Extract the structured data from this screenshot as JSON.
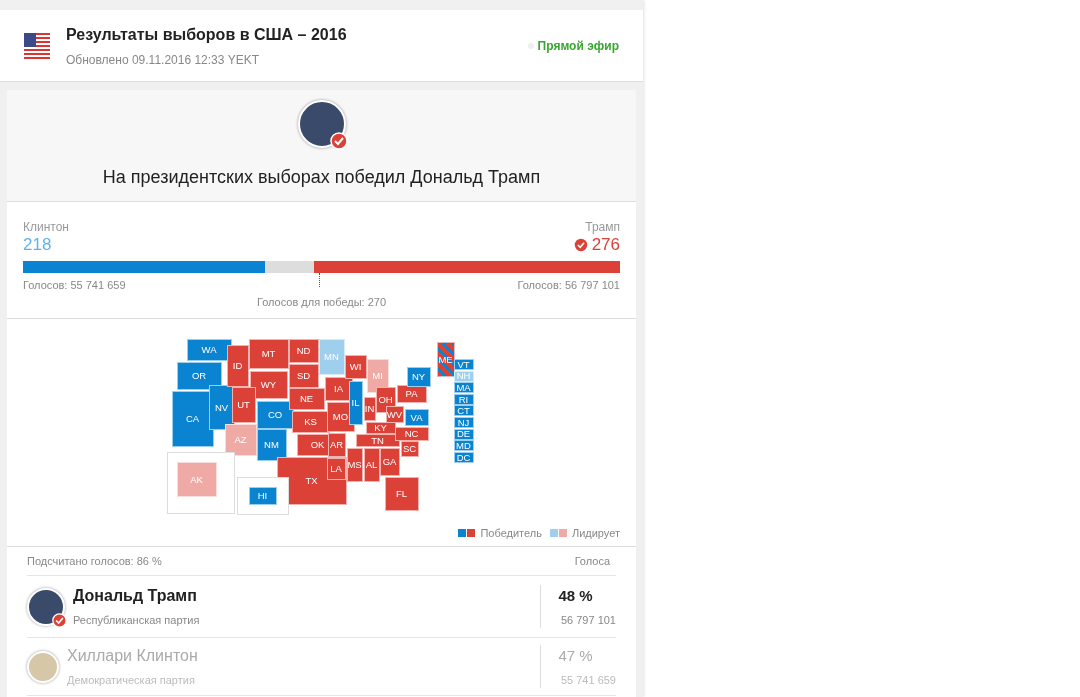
{
  "header": {
    "title": "Результаты выборов в США – 2016",
    "updated": "Обновлено 09.11.2016 12:33 YEKT",
    "live": "Прямой эфир"
  },
  "winner_banner": {
    "headline": "На президентских выборах победил Дональд Трамп",
    "winner_check": true
  },
  "electoral": {
    "left": {
      "name": "Клинтон",
      "votes": "218",
      "level": 0.405,
      "won": false,
      "popular": "Голосов: 55 741 659"
    },
    "right": {
      "name": "Трамп",
      "votes": "276",
      "level": 0.513,
      "won": true,
      "popular": "Голосов: 56 797 101"
    },
    "threshold": "Голосов для победы: 270"
  },
  "map": {
    "states": [
      {
        "label": "WA",
        "color": "#0a84d0"
      },
      {
        "label": "OR",
        "color": "#0a84d0"
      },
      {
        "label": "CA",
        "color": "#0a84d0"
      },
      {
        "label": "NV",
        "color": "#0a84d0"
      },
      {
        "label": "ID",
        "color": "#dc4137"
      },
      {
        "label": "MT",
        "color": "#dc4137"
      },
      {
        "label": "WY",
        "color": "#dc4137"
      },
      {
        "label": "UT",
        "color": "#dc4137"
      },
      {
        "label": "CO",
        "color": "#0a84d0"
      },
      {
        "label": "AZ",
        "color": "#f0aaa6"
      },
      {
        "label": "NM",
        "color": "#0a84d0"
      },
      {
        "label": "ND",
        "color": "#dc4137"
      },
      {
        "label": "SD",
        "color": "#dc4137"
      },
      {
        "label": "NE",
        "color": "#dc4137"
      },
      {
        "label": "KS",
        "color": "#dc4137"
      },
      {
        "label": "OK",
        "color": "#dc4137"
      },
      {
        "label": "TX",
        "color": "#dc4137"
      },
      {
        "label": "MN",
        "color": "#9ed0ee"
      },
      {
        "label": "IA",
        "color": "#dc4137"
      },
      {
        "label": "MO",
        "color": "#dc4137"
      },
      {
        "label": "AR",
        "color": "#dc4137"
      },
      {
        "label": "LA",
        "color": "#dc4137"
      },
      {
        "label": "WI",
        "color": "#dc4137"
      },
      {
        "label": "IL",
        "color": "#0a84d0"
      },
      {
        "label": "MI",
        "color": "#f0aaa6"
      },
      {
        "label": "IN",
        "color": "#dc4137"
      },
      {
        "label": "OH",
        "color": "#dc4137"
      },
      {
        "label": "KY",
        "color": "#dc4137"
      },
      {
        "label": "TN",
        "color": "#dc4137"
      },
      {
        "label": "MS",
        "color": "#dc4137"
      },
      {
        "label": "AL",
        "color": "#dc4137"
      },
      {
        "label": "GA",
        "color": "#dc4137"
      },
      {
        "label": "FL",
        "color": "#dc4137"
      },
      {
        "label": "NC",
        "color": "#dc4137"
      },
      {
        "label": "SC",
        "color": "#dc4137"
      },
      {
        "label": "VA",
        "color": "#0a84d0"
      },
      {
        "label": "WV",
        "color": "#dc4137"
      },
      {
        "label": "PA",
        "color": "#dc4137"
      },
      {
        "label": "NY",
        "color": "#0a84d0"
      },
      {
        "label": "ME",
        "color": "#dc4137",
        "split": true
      },
      {
        "label": "VT",
        "color": "#0a84d0"
      },
      {
        "label": "NH",
        "color": "#9ed0ee"
      },
      {
        "label": "MA",
        "color": "#0a84d0"
      },
      {
        "label": "RI",
        "color": "#0a84d0"
      },
      {
        "label": "CT",
        "color": "#0a84d0"
      },
      {
        "label": "NJ",
        "color": "#0a84d0"
      },
      {
        "label": "DE",
        "color": "#0a84d0"
      },
      {
        "label": "MD",
        "color": "#0a84d0"
      },
      {
        "label": "DC",
        "color": "#0a84d0"
      },
      {
        "label": "AK",
        "color": "#f0aaa6"
      },
      {
        "label": "HI",
        "color": "#0a84d0"
      }
    ],
    "legend": [
      {
        "label": "Победитель",
        "kind": "winner"
      },
      {
        "label": "Лидирует",
        "kind": "leading"
      }
    ]
  },
  "results": {
    "counted": "Подсчитано голосов: 86 %",
    "votes_heading": "Голоса",
    "rows": [
      {
        "name": "Дональд Трамп",
        "party": "Республиканская партия",
        "percent": "48 %",
        "votes": "56 797 101",
        "winner": true
      },
      {
        "name": "Хиллари Клинтон",
        "party": "Демократическая партия",
        "percent": "47 %",
        "votes": "55 741 659",
        "winner": false
      }
    ],
    "cut_row": true
  }
}
